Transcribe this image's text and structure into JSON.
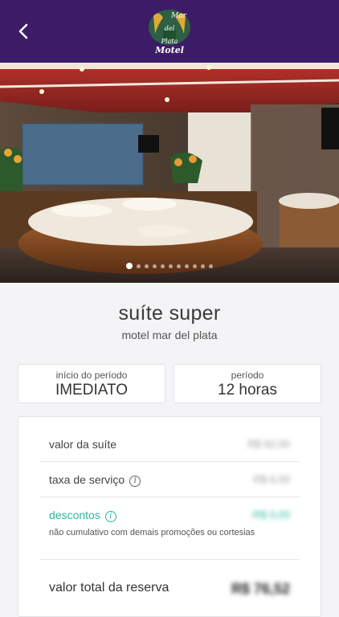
{
  "header": {
    "logo_text_top": "Mar",
    "logo_text_mid": "del",
    "logo_text_plata": "Plata",
    "logo_text_bottom": "Motel",
    "background_color": "#3d1c67"
  },
  "gallery": {
    "total_images": 11,
    "active_index": 0
  },
  "suite": {
    "title": "suíte super",
    "motel_name": "motel mar del plata"
  },
  "period_start": {
    "label": "início do período",
    "value": "IMEDIATO"
  },
  "period": {
    "label": "período",
    "value": "12 horas"
  },
  "pricing": {
    "suite_value_label": "valor da suíte",
    "suite_value": "R$ 62,00",
    "service_fee_label": "taxa de serviço",
    "service_fee": "R$ 6,00",
    "discounts_label": "descontos",
    "discounts_value": "-R$ 0,00",
    "discounts_note": "não cumulativo com demais promoções ou cortesias",
    "total_label": "valor total da reserva",
    "total_value": "R$ 76,52",
    "accent_color": "#2bb8a0"
  }
}
